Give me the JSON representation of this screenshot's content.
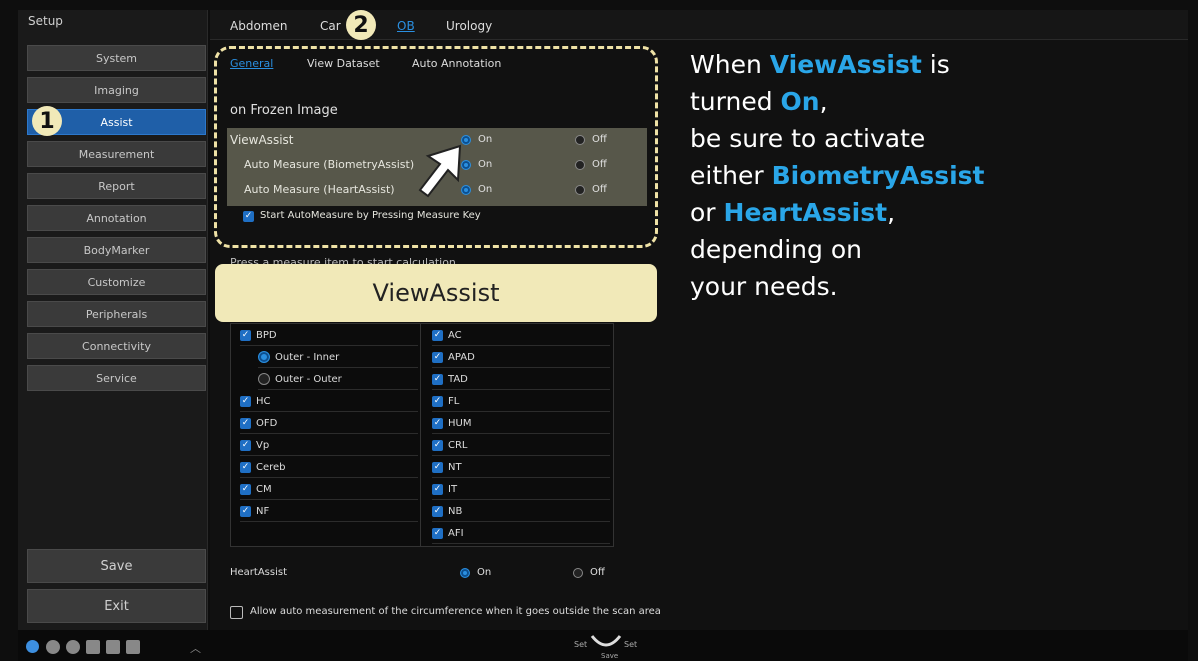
{
  "sidebar": {
    "title": "Setup",
    "items": [
      {
        "label": "System"
      },
      {
        "label": "Imaging"
      },
      {
        "label": "Assist",
        "active": true
      },
      {
        "label": "Measurement"
      },
      {
        "label": "Report"
      },
      {
        "label": "Annotation"
      },
      {
        "label": "BodyMarker"
      },
      {
        "label": "Customize"
      },
      {
        "label": "Peripherals"
      },
      {
        "label": "Connectivity"
      },
      {
        "label": "Service"
      }
    ],
    "save_label": "Save",
    "exit_label": "Exit"
  },
  "top_tabs": [
    {
      "label": "Abdomen"
    },
    {
      "label": "Car"
    },
    {
      "label": "OB",
      "active": true
    },
    {
      "label": "Urology"
    }
  ],
  "sub_tabs": [
    {
      "label": "General",
      "active": true
    },
    {
      "label": "View Dataset"
    },
    {
      "label": "Auto Annotation"
    }
  ],
  "frozen": {
    "heading": "on Frozen Image",
    "viewassist_label": "ViewAssist",
    "biometry_label": "Auto Measure (BiometryAssist)",
    "heart_label": "Auto Measure (HeartAssist)",
    "on_label": "On",
    "off_label": "Off",
    "start_auto": "Start AutoMeasure by Pressing Measure Key"
  },
  "measure_hint": "Press a measure item to start calculation",
  "callout": "ViewAssist",
  "table": {
    "left": [
      {
        "label": "BPD",
        "type": "check"
      },
      {
        "label": "Outer - Inner",
        "type": "radio-on"
      },
      {
        "label": "Outer - Outer",
        "type": "radio-off"
      },
      {
        "label": "HC",
        "type": "check"
      },
      {
        "label": "OFD",
        "type": "check"
      },
      {
        "label": "Vp",
        "type": "check"
      },
      {
        "label": "Cereb",
        "type": "check"
      },
      {
        "label": "CM",
        "type": "check"
      },
      {
        "label": "NF",
        "type": "check"
      },
      {
        "label": "",
        "type": "none"
      }
    ],
    "right": [
      {
        "label": "AC"
      },
      {
        "label": "APAD"
      },
      {
        "label": "TAD"
      },
      {
        "label": "FL"
      },
      {
        "label": "HUM"
      },
      {
        "label": "CRL"
      },
      {
        "label": "NT"
      },
      {
        "label": "IT"
      },
      {
        "label": "NB"
      },
      {
        "label": "AFI"
      }
    ]
  },
  "heartassist": {
    "label": "HeartAssist",
    "on": "On",
    "off": "Off"
  },
  "bottom_check": "Allow auto measurement of the circumference when it goes outside the scan area",
  "note": {
    "l1a": "When ",
    "l1b": "ViewAssist",
    "l1c": " is",
    "l2a": "turned ",
    "l2b": "On",
    "l2c": ",",
    "l3": "be sure to activate",
    "l4a": "either ",
    "l4b": "BiometryAssist",
    "l5a": "or ",
    "l5b": "HeartAssist",
    "l5c": ",",
    "l6": "depending on",
    "l7": "your needs."
  },
  "badges": {
    "one": "1",
    "two": "2"
  },
  "statusbar": {
    "set_left": "Set",
    "set_right": "Set",
    "save": "Save"
  },
  "colors": {
    "accent": "#2a8fe0",
    "highlight": "#2aa6e8",
    "callout_bg": "#f1e9b8",
    "panel": "#57574a"
  }
}
